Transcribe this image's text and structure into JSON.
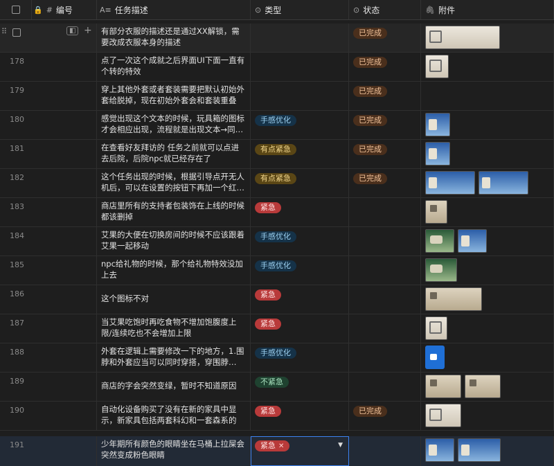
{
  "header": {
    "id_label": "编号",
    "desc_label": "任务描述",
    "type_label": "类型",
    "status_label": "状态",
    "att_label": "附件"
  },
  "rows": [
    {
      "num": "",
      "desc": "有部分衣服的描述还是通过XX解锁，需要改成衣服本身的描述",
      "type": "",
      "status": "已完成"
    },
    {
      "num": "178",
      "desc": "点了一次这个成就之后界面UI下面一直有个转的特效",
      "type": "",
      "status": "已完成"
    },
    {
      "num": "179",
      "desc": "穿上其他外套或者套装需要把默认初始外套给脱掉，现在初始外套会和套装重叠",
      "type": "",
      "status": "已完成"
    },
    {
      "num": "180",
      "desc": "感觉出现这个文本的时候，玩具箱的图标才会相应出现，流程就是出现文本→同时在…",
      "type": "手感优化",
      "status": "已完成"
    },
    {
      "num": "181",
      "desc": "在查看好友拜访的 任务之前就可以点进去后院，后院npc就已经存在了",
      "type": "有点紧急",
      "status": "已完成"
    },
    {
      "num": "182",
      "desc": "这个任务出现的时候，根据引导点开无人机后，可以在设置的按钮下再加一个红箭头",
      "type": "有点紧急",
      "status": "已完成"
    },
    {
      "num": "183",
      "desc": "商店里所有的支持者包装饰在上线的时候都该删掉",
      "type": "紧急",
      "status": ""
    },
    {
      "num": "184",
      "desc": "艾果的大便在切换房间的时候不应该跟着艾果一起移动",
      "type": "手感优化",
      "status": ""
    },
    {
      "num": "185",
      "desc": "npc给礼物的时候，那个给礼物特效没加上去",
      "type": "手感优化",
      "status": ""
    },
    {
      "num": "186",
      "desc": "这个图标不对",
      "type": "紧急",
      "status": ""
    },
    {
      "num": "187",
      "desc": "当艾果吃饱时再吃食物不增加饱腹度上限/连续吃也不会增加上限",
      "type": "紧急",
      "status": ""
    },
    {
      "num": "188",
      "desc": "外套在逻辑上需要修改一下的地方，1.围脖和外套应当可以同时穿搭，穿围脖…",
      "type": "手感优化",
      "status": ""
    },
    {
      "num": "189",
      "desc": "商店的字会突然变绿，暂时不知道原因",
      "type": "不紧急",
      "status": ""
    },
    {
      "num": "190",
      "desc": "自动化设备购买了没有在新的家具中显示，新家具包括两套科幻和一套森系的",
      "type": "紧急",
      "status": "已完成"
    },
    {
      "num": "191",
      "desc": "少年期所有颜色的眼睛坐在马桶上拉屎会突然变成粉色眼睛",
      "type": "紧急",
      "status": ""
    }
  ]
}
